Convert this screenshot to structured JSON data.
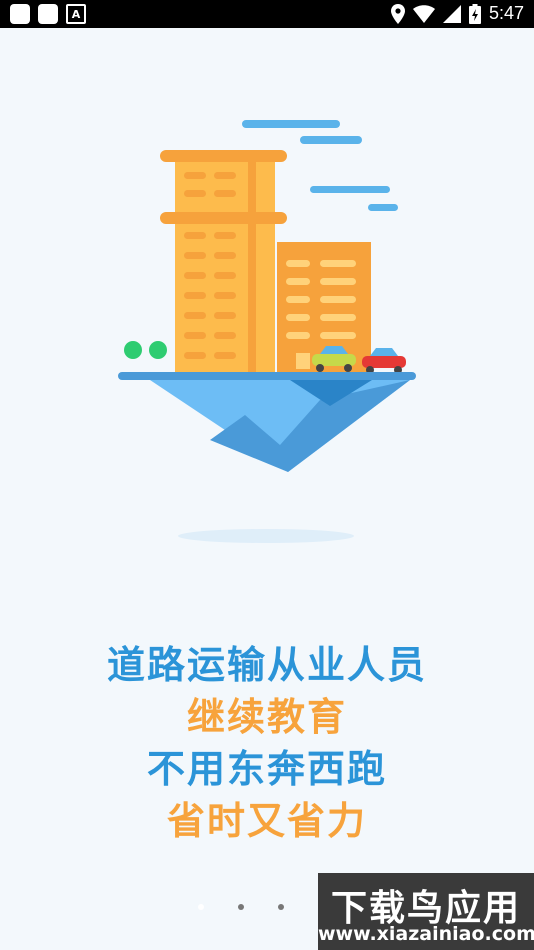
{
  "status_bar": {
    "time": "5:47"
  },
  "onboarding": {
    "lines": [
      "道路运输从业人员",
      "继续教育",
      "不用东奔西跑",
      "省时又省力"
    ],
    "page_count": 3,
    "active_page": 1
  },
  "watermark": {
    "title": "下载鸟应用",
    "url": "www.xiazainiao.com"
  },
  "colors": {
    "blue": "#2b94d8",
    "orange": "#f7a33c",
    "background": "#f3f8fc"
  }
}
